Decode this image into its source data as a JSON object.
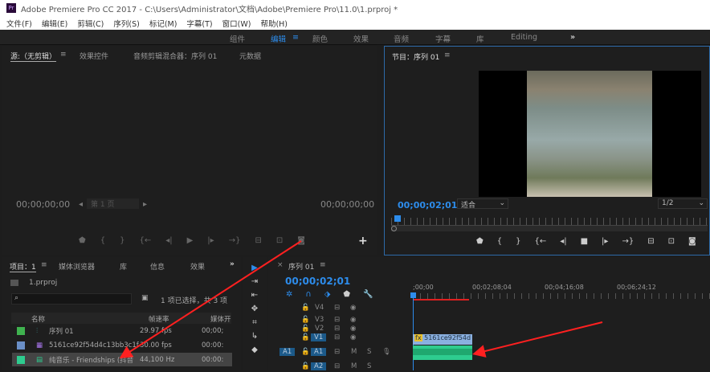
{
  "title": "Adobe Premiere Pro CC 2017 - C:\\Users\\Administrator\\文档\\Adobe\\Premiere Pro\\11.0\\1.prproj *",
  "app_badge": "Pr",
  "menu": [
    "文件(F)",
    "编辑(E)",
    "剪辑(C)",
    "序列(S)",
    "标记(M)",
    "字幕(T)",
    "窗口(W)",
    "帮助(H)"
  ],
  "workspaces": [
    "组件",
    "编辑",
    "颜色",
    "效果",
    "音频",
    "字幕",
    "库",
    "Editing"
  ],
  "workspace_active": "编辑",
  "workspace_more": "»",
  "source": {
    "tabs": [
      "源:（无剪辑）",
      "效果控件",
      "音频剪辑混合器：序列 01",
      "元数据"
    ],
    "timecode_left": "00;00;00;00",
    "timecode_right": "00;00;00;00",
    "page": "第 1 页",
    "add": "+"
  },
  "program": {
    "tab": "节目：序列 01",
    "timecode": "00;00;02;01",
    "fit": "适合",
    "resolution": "1/2"
  },
  "project": {
    "tabs": [
      "项目：1",
      "媒体浏览器",
      "库",
      "信息",
      "效果"
    ],
    "file": "1.prproj",
    "selection": "1 项已选择，共 3 项",
    "columns": [
      "名称",
      "帧速率",
      "媒体开"
    ],
    "items": [
      {
        "name": "序列 01",
        "rate": "29.97 fps",
        "start": "00;00;",
        "color": "#3fb24f"
      },
      {
        "name": "5161ce92f54d4c13bb3c1f",
        "rate": "30.00 fps",
        "start": "00:00:",
        "color": "#6a8fc7"
      },
      {
        "name": "纯音乐 - Friendships (抖音",
        "rate": "44,100 Hz",
        "start": "00:00:",
        "color": "#2ecc8f"
      }
    ]
  },
  "timeline": {
    "tab": "序列 01",
    "timecode": "00;00;02;01",
    "ruler": [
      ";00;00",
      "00;02;08;04",
      "00;04;16;08",
      "00;06;24;12"
    ],
    "video_tracks": [
      "V4",
      "V3",
      "V2",
      "V1"
    ],
    "audio_tracks": [
      "A1",
      "A2"
    ],
    "source_patch": "A1",
    "clip_video": "5161ce92f54d",
    "fx": "fx",
    "m": "M",
    "s": "S"
  },
  "colors": {
    "accent": "#2d8ceb",
    "arrow": "#ff2020",
    "audio_clip": "#2ecc8f"
  }
}
